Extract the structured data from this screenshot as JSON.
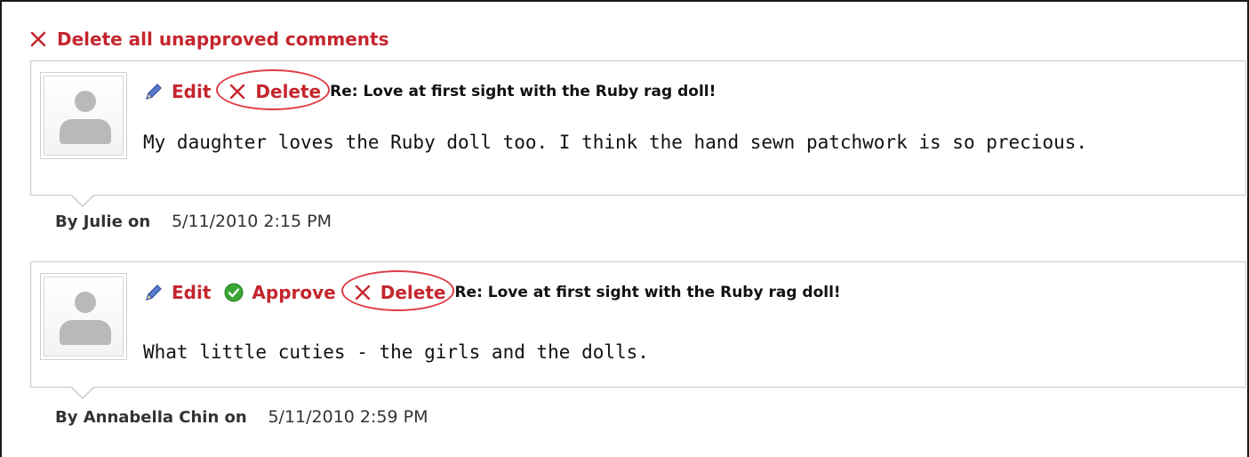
{
  "delete_all": {
    "label": "Delete all unapproved comments"
  },
  "comments": [
    {
      "actions": {
        "edit": "Edit",
        "delete": "Delete"
      },
      "title": "Re: Love at first sight with the Ruby rag doll!",
      "text": "My daughter loves the Ruby doll too. I think the hand sewn patchwork is so precious.",
      "byline": "By Julie on",
      "date": "5/11/2010 2:15 PM"
    },
    {
      "actions": {
        "edit": "Edit",
        "approve": "Approve",
        "delete": "Delete"
      },
      "title": "Re: Love at first sight with the Ruby rag doll!",
      "text": "What little cuties - the girls and the dolls.",
      "byline": "By Annabella Chin on",
      "date": "5/11/2010 2:59 PM"
    }
  ],
  "colors": {
    "accent": "#c4262e",
    "highlight": "#e03b45",
    "approve_green": "#3aa635"
  },
  "icons": {
    "edit": "pencil-icon",
    "delete": "close-icon",
    "approve": "checkmark-icon"
  }
}
